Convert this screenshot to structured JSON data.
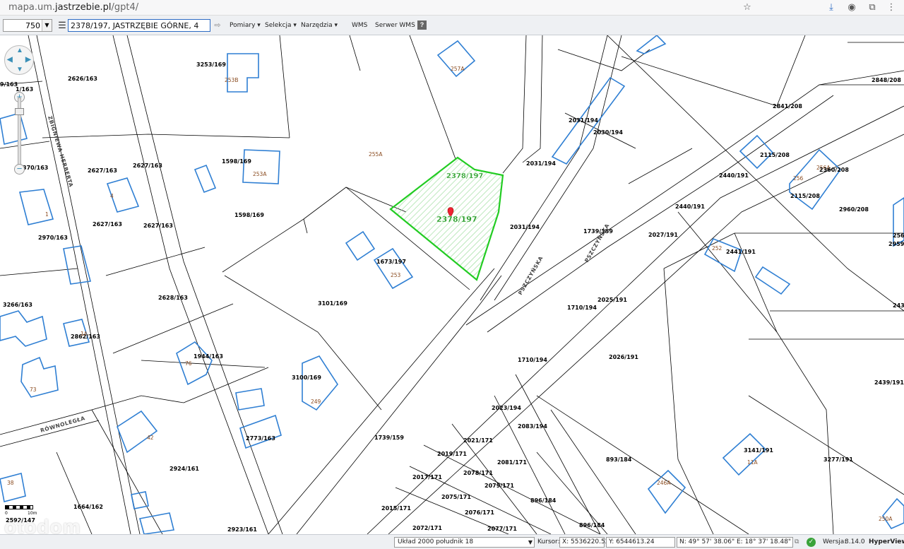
{
  "browser": {
    "url_prefix": "mapa.um.",
    "url_host": "jastrzebie.pl",
    "url_path": "/gpt4/"
  },
  "toolbar": {
    "scale_value": "750",
    "search_value": "2378/197, JASTRZĘBIE GÓRNE, 4",
    "menus": [
      "Pomiary ▾",
      "Selekcja ▾",
      "Narzędzia ▾"
    ],
    "links": [
      "WMS",
      "Serwer WMS"
    ],
    "help": "?"
  },
  "map": {
    "highlight_color": "#22cc22",
    "building_color": "#2f7fd3",
    "parcel_labels": [
      "2626/163",
      "3253/169",
      "253B",
      "257A",
      "2848/208",
      "2841/208",
      "2031/194",
      "2030/194",
      "2115/208",
      "256A",
      "2360/208",
      "256",
      "2115/208",
      "2440/191",
      "2960/208",
      "2627/163",
      "2627/163",
      "1598/169",
      "253A",
      "255A",
      "2031/194",
      "2627/163",
      "2627/163",
      "2970/163",
      "1598/169",
      "1",
      "4",
      "2031/194",
      "1739/159",
      "2440/191",
      "2027/191",
      "252",
      "2441/191",
      "1673/197",
      "253",
      "3266/163",
      "2628/163",
      "3101/169",
      "1710/194",
      "2025/191",
      "2862/163",
      "1A",
      "1944/163",
      "76",
      "1710/194",
      "2026/191",
      "3100/169",
      "249",
      "2439/191",
      "73",
      "2023/194",
      "2083/194",
      "2773/163",
      "1739/159",
      "42",
      "2021/171",
      "2019/171",
      "2081/171",
      "893/184",
      "3141/191",
      "11A",
      "3277/191",
      "2924/161",
      "2017/171",
      "2078/171",
      "2079/171",
      "246A",
      "38",
      "2075/171",
      "896/184",
      "1664/162",
      "2015/171",
      "2076/171",
      "2077/171",
      "896/184",
      "2072/171",
      "2923/161",
      "250A",
      "2592/147",
      "2959/",
      "256/",
      "1/163",
      "9/163",
      "2438/",
      "370/163"
    ],
    "selected_label_top": "2378/197",
    "selected_label_center": "2378/197",
    "street_labels": [
      "ZBIGNIEWA HERBERTA",
      "PSZCZYŃSKA",
      "PSZCZYŃSKA",
      "RÓWNOLEGŁA"
    ]
  },
  "scalebar": {
    "label_left": "0",
    "label_right": "10m"
  },
  "watermark": "otodom",
  "status": {
    "crs": "Układ 2000 południk 18",
    "cursor_label": "Kursor:",
    "x": "X: 5536220.52",
    "y": "Y: 6544613.24",
    "latlon": "N: 49° 57' 38.06\" E: 18° 37' 18.48\"",
    "version_label": "Wersja:",
    "version": "8.14.0",
    "brand": "HyperView"
  }
}
